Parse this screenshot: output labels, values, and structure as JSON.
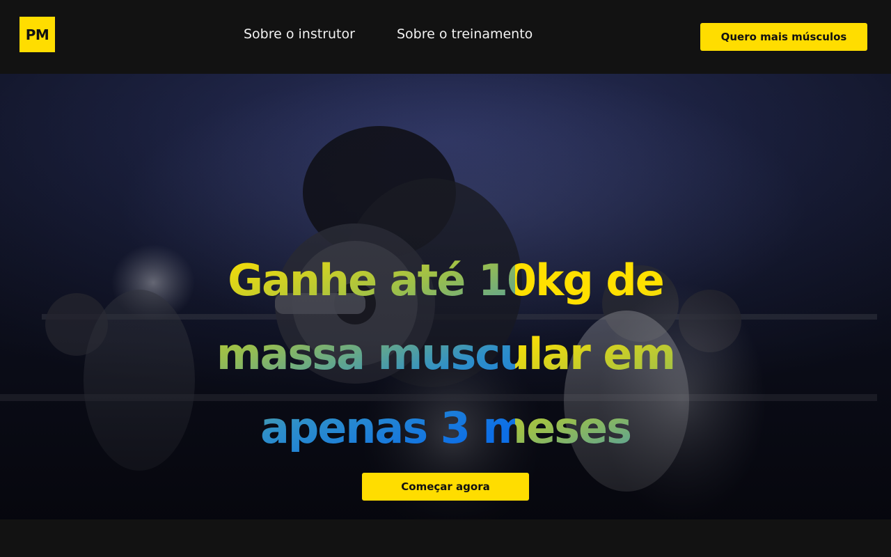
{
  "header": {
    "logo_text": "PM",
    "nav": [
      {
        "label": "Sobre o instrutor"
      },
      {
        "label": "Sobre o treinamento"
      }
    ],
    "cta_label": "Quero mais músculos"
  },
  "hero": {
    "headline": {
      "line1": "Ganhe até 10kg de",
      "line2": "massa muscular em",
      "line3": "apenas 3 meses"
    },
    "cta_label": "Começar agora"
  },
  "colors": {
    "accent": "#FFDD00",
    "background": "#121212",
    "gradient_start": "#FFE000",
    "gradient_end": "#0D6FE6"
  }
}
